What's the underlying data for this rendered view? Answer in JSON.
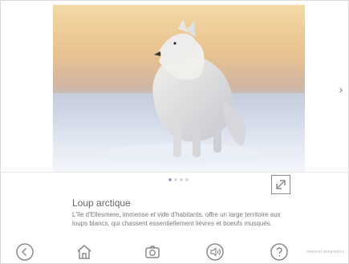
{
  "viewer": {
    "next_icon": "chevron-right-icon",
    "pagination": {
      "count": 4,
      "active_index": 0
    },
    "expand_icon": "expand-icon"
  },
  "content": {
    "title": "Loup arctique",
    "description": "L'île d'Ellesmere, immense et vide d'habitants, offre un large territoire aux loups blancs, qui chassent essentiellement lièvres et boeufs musqués."
  },
  "toolbar": {
    "items": [
      {
        "icon": "back-icon"
      },
      {
        "icon": "home-icon"
      },
      {
        "icon": "camera-icon"
      },
      {
        "icon": "audio-icon"
      },
      {
        "icon": "help-icon"
      }
    ],
    "brand_text": "national geographic"
  },
  "colors": {
    "accent": "#8aa4c8",
    "icon_stroke": "#8c8c8c"
  }
}
